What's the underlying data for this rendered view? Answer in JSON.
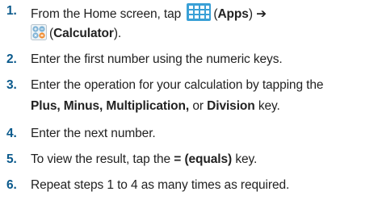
{
  "steps": [
    {
      "number": "1.",
      "pre": "From the Home screen, tap",
      "apps_paren": "(",
      "apps_label": "Apps",
      "apps_close": ")",
      "arrow": "➔",
      "calc_paren": "(",
      "calc_label": "Calculator",
      "calc_close": ")."
    },
    {
      "number": "2.",
      "text": "Enter the first number using the numeric keys."
    },
    {
      "number": "3.",
      "line1": "Enter the operation for your calculation by tapping the",
      "plus_minus": "Plus, Minus, Multiplication,",
      "or_word": "or",
      "division": "Division",
      "key_word": "key."
    },
    {
      "number": "4.",
      "text": "Enter the next number."
    },
    {
      "number": "5.",
      "pre": "To view the result, tap the",
      "equals": "=",
      "equals_label": "(equals)",
      "post": "key."
    },
    {
      "number": "6.",
      "text": "Repeat steps 1 to 4 as many times as required."
    }
  ],
  "icons": {
    "apps": "apps-grid-icon",
    "calculator": "calculator-icon"
  },
  "colors": {
    "step_number": "#0b5a8c",
    "apps_icon": "#3aa0d6",
    "text": "#222222"
  }
}
